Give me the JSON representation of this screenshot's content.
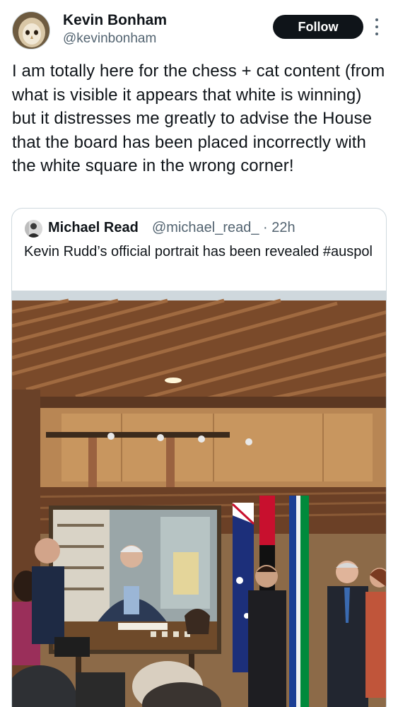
{
  "author": {
    "name": "Kevin Bonham",
    "handle": "@kevinbonham",
    "follow_label": "Follow"
  },
  "tweet": {
    "text": "I am totally here for the chess + cat content (from what is visible it appears that white is winning) but it distresses me greatly to advise the House that the board has been placed incorrectly with the white square in the wrong corner!"
  },
  "quoted": {
    "name": "Michael Read",
    "handle": "@michael_read_ · 22h",
    "text": "Kevin Rudd’s official portrait has been revealed #auspol"
  },
  "icons": {
    "more": "more-vertical-icon",
    "avatar": "owl-avatar",
    "quoted_avatar": "person-avatar"
  },
  "colors": {
    "text": "#0f1419",
    "secondary": "#536471",
    "border": "#cfd9de",
    "button": "#0f1419"
  }
}
